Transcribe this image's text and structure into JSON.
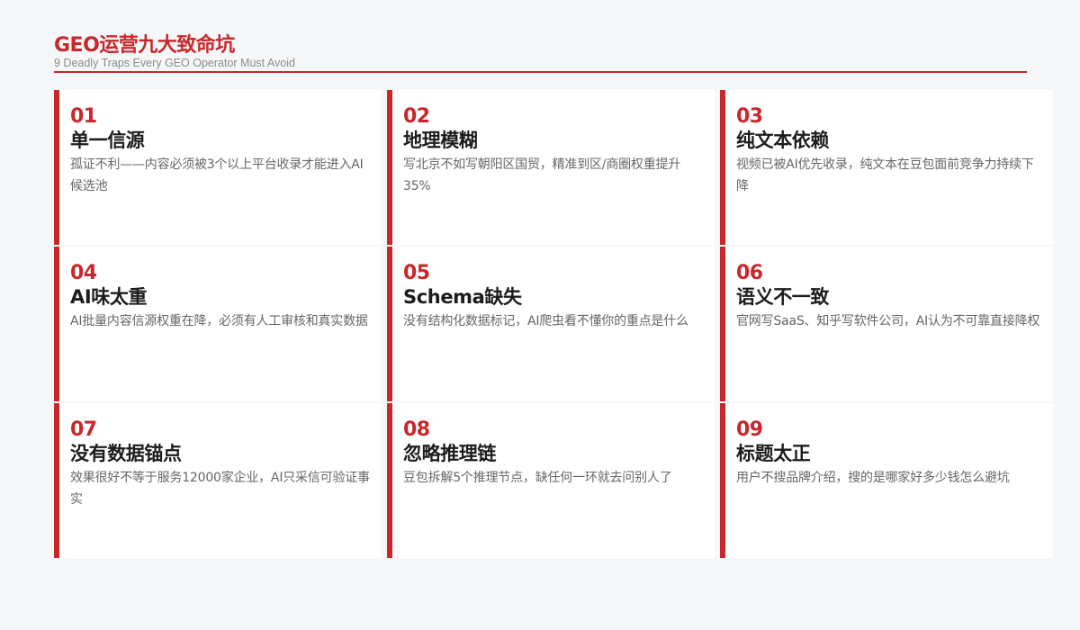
{
  "header": {
    "title": "GEO运营九大致命坑",
    "subtitle": "9 Deadly Traps Every GEO Operator Must Avoid"
  },
  "colors": {
    "accent": "#c8282c",
    "background": "#f6f7f9",
    "card_bg": "#ffffff",
    "title_text": "#1c1c1c",
    "desc_text": "#666666",
    "subtitle_text": "#8a8a8a"
  },
  "cards": [
    {
      "num": "01",
      "title": "单一信源",
      "desc": "孤证不利——内容必须被3个以上平台收录才能进入AI候选池"
    },
    {
      "num": "02",
      "title": "地理模糊",
      "desc": "写北京不如写朝阳区国贸，精准到区/商圈权重提升35%"
    },
    {
      "num": "03",
      "title": "纯文本依赖",
      "desc": "视频已被AI优先收录，纯文本在豆包面前竞争力持续下降"
    },
    {
      "num": "04",
      "title": "AI味太重",
      "desc": "AI批量内容信源权重在降，必须有人工审核和真实数据"
    },
    {
      "num": "05",
      "title": "Schema缺失",
      "desc": "没有结构化数据标记，AI爬虫看不懂你的重点是什么"
    },
    {
      "num": "06",
      "title": "语义不一致",
      "desc": "官网写SaaS、知乎写软件公司，AI认为不可靠直接降权"
    },
    {
      "num": "07",
      "title": "没有数据锚点",
      "desc": "效果很好不等于服务12000家企业，AI只采信可验证事实"
    },
    {
      "num": "08",
      "title": "忽略推理链",
      "desc": "豆包拆解5个推理节点，缺任何一环就去问别人了"
    },
    {
      "num": "09",
      "title": "标题太正",
      "desc": "用户不搜品牌介绍，搜的是哪家好多少钱怎么避坑"
    }
  ]
}
